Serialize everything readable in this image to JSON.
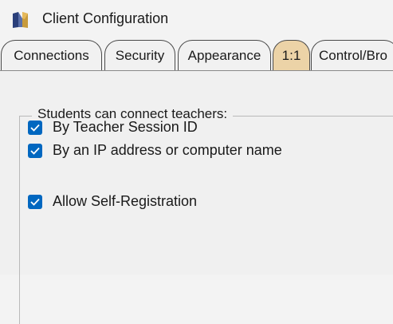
{
  "window": {
    "title": "Client Configuration",
    "icon": "app-logo-icon"
  },
  "tabs": [
    {
      "label": "Connections",
      "active": false
    },
    {
      "label": "Security",
      "active": false
    },
    {
      "label": "Appearance",
      "active": false
    },
    {
      "label": "1:1",
      "active": true
    },
    {
      "label": "Control/Bro",
      "active": false
    }
  ],
  "group": {
    "label": "Students can connect teachers:"
  },
  "options": [
    {
      "label": "By Teacher Session ID",
      "checked": true
    },
    {
      "label": "By an IP address or computer name",
      "checked": true
    },
    {
      "label": "Allow Self-Registration",
      "checked": true
    }
  ],
  "colors": {
    "accent": "#0067c0",
    "active_tab": "#ecd3a7"
  }
}
